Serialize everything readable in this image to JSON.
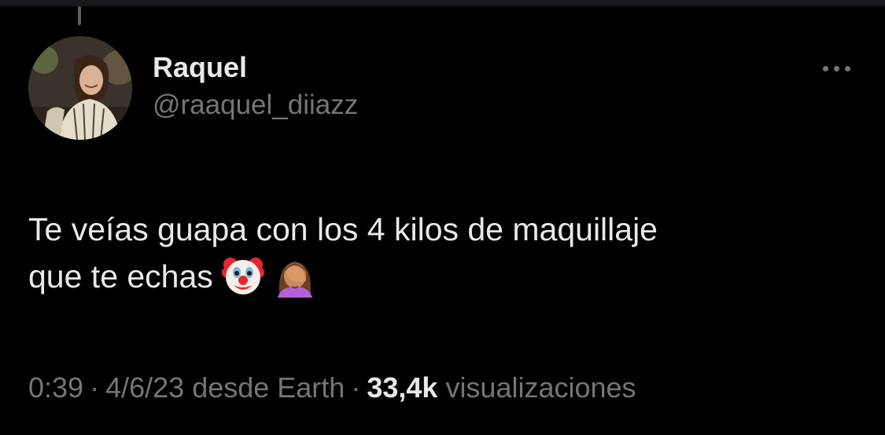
{
  "tweet": {
    "author": {
      "display_name": "Raquel",
      "handle": "@raaquel_diiazz",
      "avatar_icon": "profile-photo"
    },
    "text_line_1": "Te veías guapa con los 4 kilos de maquillaje",
    "text_line_2": "que te echas",
    "emojis": [
      "clown-face-emoji",
      "face-palm-emoji"
    ],
    "time": "0:39",
    "date": "4/6/23",
    "source": "desde Earth",
    "separator": "·",
    "views_count": "33,4k",
    "views_label": "visualizaciones"
  },
  "icons": {
    "more": "more-options-icon"
  },
  "colors": {
    "background": "#000000",
    "text_primary": "#e7e9ea",
    "text_secondary": "#71767b"
  }
}
